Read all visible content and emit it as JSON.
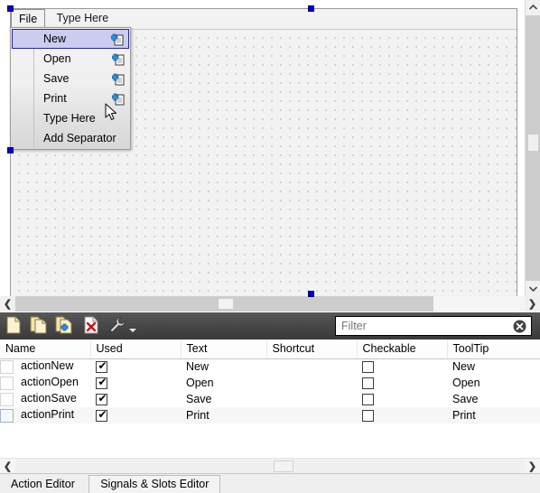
{
  "form": {
    "menubar": {
      "items": [
        {
          "label": "File",
          "state": "active"
        },
        {
          "label": "Type Here",
          "state": "placeholder"
        }
      ]
    },
    "menu_popup": {
      "items": [
        {
          "label": "New",
          "icon": "new-action-icon",
          "selected": true
        },
        {
          "label": "Open",
          "icon": "new-action-icon",
          "selected": false
        },
        {
          "label": "Save",
          "icon": "new-action-icon",
          "selected": false
        },
        {
          "label": "Print",
          "icon": "new-action-icon",
          "selected": false
        },
        {
          "label": "Type Here",
          "icon": "",
          "selected": false
        },
        {
          "label": "Add Separator",
          "icon": "",
          "selected": false
        }
      ]
    }
  },
  "toolbar": {
    "buttons": [
      {
        "name": "new-action-button",
        "icon": "new-file-icon"
      },
      {
        "name": "copy-action-button",
        "icon": "copy-file-icon"
      },
      {
        "name": "edit-action-button",
        "icon": "edit-file-icon"
      },
      {
        "name": "delete-action-button",
        "icon": "delete-file-icon"
      },
      {
        "name": "view-options-button",
        "icon": "wrench-icon"
      }
    ],
    "filter": {
      "value": "",
      "placeholder": "Filter",
      "clear_label": "✕"
    }
  },
  "table": {
    "columns": [
      "Name",
      "Used",
      "Text",
      "Shortcut",
      "Checkable",
      "ToolTip"
    ],
    "rows": [
      {
        "name": "actionNew",
        "used": true,
        "text": "New",
        "shortcut": "",
        "checkable": false,
        "tooltip": "New",
        "selected": false
      },
      {
        "name": "actionOpen",
        "used": true,
        "text": "Open",
        "shortcut": "",
        "checkable": false,
        "tooltip": "Open",
        "selected": false
      },
      {
        "name": "actionSave",
        "used": true,
        "text": "Save",
        "shortcut": "",
        "checkable": false,
        "tooltip": "Save",
        "selected": false
      },
      {
        "name": "actionPrint",
        "used": true,
        "text": "Print",
        "shortcut": "",
        "checkable": false,
        "tooltip": "Print",
        "selected": true
      }
    ]
  },
  "tabs": [
    {
      "label": "Action Editor",
      "active": true
    },
    {
      "label": "Signals & Slots Editor",
      "active": false
    }
  ],
  "scrollbars": {
    "designer_v": {
      "up": "⌃",
      "down": "⌄"
    },
    "designer_h": {
      "left": "❮",
      "right": "❯"
    },
    "bottom_h": {
      "left": "❮",
      "right": "❯"
    }
  },
  "colors": {
    "selection_handle": "#0000c8",
    "menu_highlight_bg": "#ccccf0",
    "menu_highlight_border": "#2323a8",
    "toolbar_bg": "#3f3f3f",
    "canvas_bg": "#f2f2f2"
  }
}
